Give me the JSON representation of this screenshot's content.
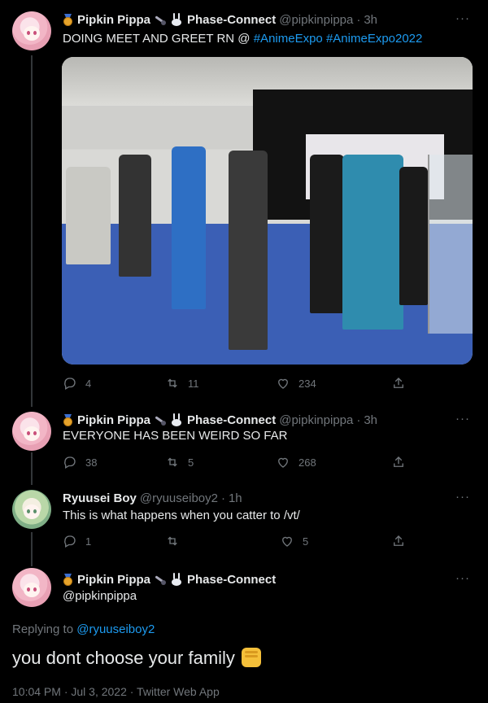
{
  "tweet1": {
    "name": "Pipkin Pippa",
    "name2": "Phase-Connect",
    "handle": "@pipkinpippa",
    "dot": "·",
    "time": "3h",
    "text_prefix": "DOING MEET AND GREET RN @ ",
    "tag1": "#AnimeExpo",
    "tag2": "#AnimeExpo2022",
    "more": "···",
    "replies": "4",
    "retweets": "11",
    "likes": "234"
  },
  "tweet2": {
    "name": "Pipkin Pippa",
    "name2": "Phase-Connect",
    "handle": "@pipkinpippa",
    "dot": "·",
    "time": "3h",
    "text": "EVERYONE HAS BEEN WEIRD SO FAR",
    "more": "···",
    "replies": "38",
    "retweets": "5",
    "likes": "268"
  },
  "tweet3": {
    "name": "Ryuusei Boy",
    "handle": "@ryuuseiboy2",
    "dot": "·",
    "time": "1h",
    "text": "This is what happens when you catter to /vt/",
    "more": "···",
    "replies": "1",
    "retweets": "",
    "likes": "5"
  },
  "main": {
    "name": "Pipkin Pippa",
    "name2": "Phase-Connect",
    "handle": "@pipkinpippa",
    "more": "···",
    "replying_to_label": "Replying to ",
    "replying_to_handle": "@ryuuseiboy2",
    "text": "you dont choose your family",
    "timestamp": "10:04 PM · Jul 3, 2022 · Twitter Web App"
  },
  "colors": {
    "accent": "#1d9bf0",
    "muted": "#71767b",
    "background": "#000000"
  },
  "icons": [
    "reply-icon",
    "retweet-icon",
    "like-icon",
    "share-icon",
    "more-icon",
    "medal-icon",
    "microphone-icon",
    "bunny-icon",
    "fist-icon"
  ]
}
